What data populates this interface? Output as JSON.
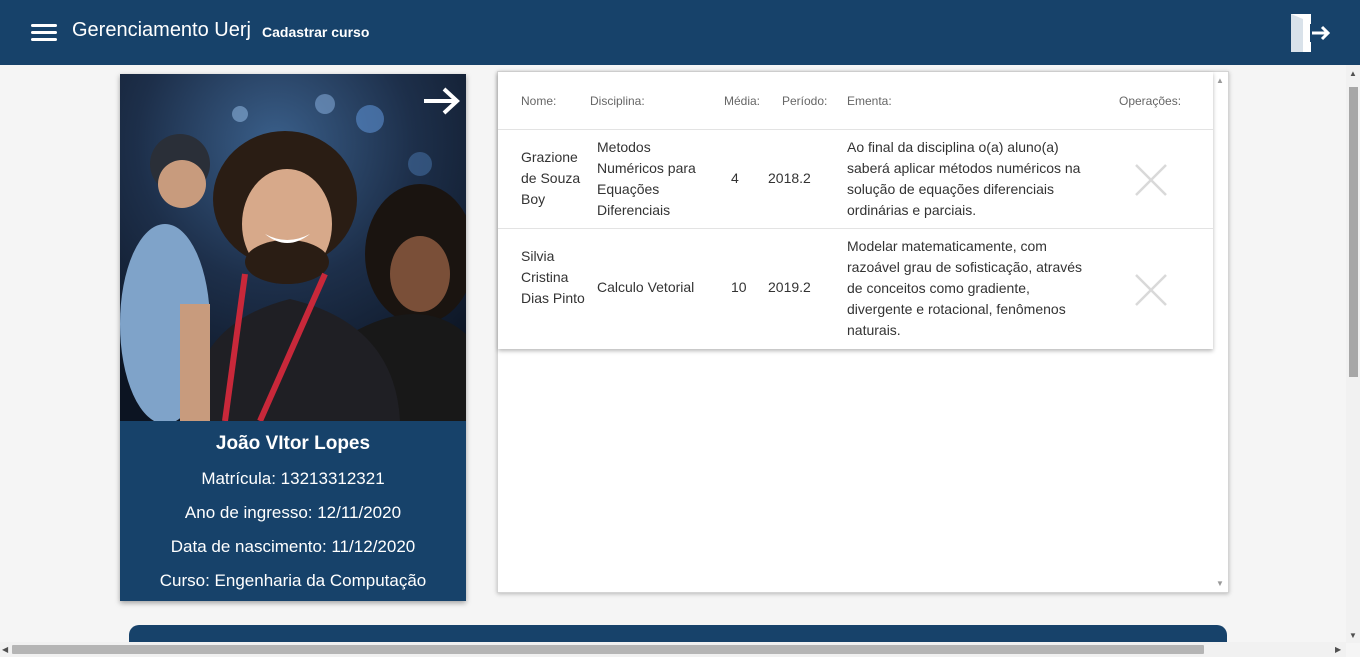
{
  "topbar": {
    "brand": "Gerenciamento Uerj",
    "nav_link": "Cadastrar curso"
  },
  "icons": {
    "menu": "hamburger-menu-icon",
    "logout": "door-exit-icon",
    "next": "arrow-right-icon",
    "delete": "close-x-icon"
  },
  "profile": {
    "name": "João VItor Lopes",
    "matricula": "Matrícula: 13213312321",
    "ingresso": "Ano de ingresso: 12/11/2020",
    "nascimento": "Data de nascimento: 11/12/2020",
    "curso": "Curso: Engenharia da Computação"
  },
  "table": {
    "headers": {
      "nome": "Nome:",
      "disciplina": "Disciplina:",
      "media": "Média:",
      "periodo": "Período:",
      "ementa": "Ementa:",
      "operacoes": "Operações:"
    },
    "rows": [
      {
        "nome": "Grazione de Souza Boy",
        "disciplina": "Metodos Numéricos para Equações Diferenciais",
        "media": "4",
        "periodo": "2018.2",
        "ementa": "Ao final da disciplina o(a) aluno(a) saberá aplicar métodos numéricos na solução de equações diferenciais ordinárias e parciais."
      },
      {
        "nome": "Silvia Cristina Dias Pinto",
        "disciplina": "Calculo Vetorial",
        "media": "10",
        "periodo": "2019.2",
        "ementa": "Modelar matematicamente, com razoável grau de sofisticação, através de conceitos como gradiente, divergente e rotacional, fenômenos naturais."
      }
    ]
  },
  "colors": {
    "primary": "#17426a",
    "page_background": "#f5f5f5",
    "delete_icon": "#d9d9d9"
  }
}
